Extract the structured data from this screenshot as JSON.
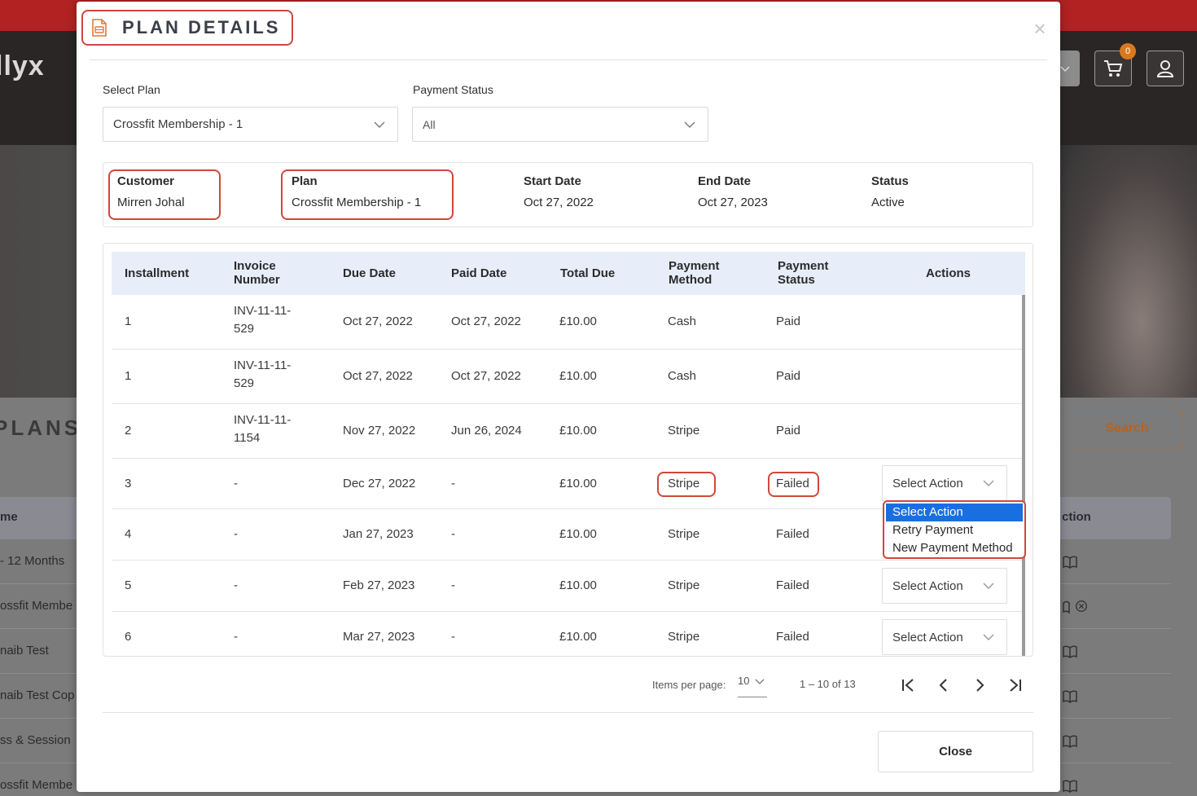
{
  "background": {
    "brand": "llyx",
    "cart_count": "0",
    "plans_title": "PLANS",
    "search_label": "Search",
    "table_header_left": "me",
    "table_header_right": "ction",
    "rows": [
      "- 12 Months",
      "ossfit Membe",
      "naib Test",
      "naib Test Cop",
      "ss & Session",
      "ossfit Membe"
    ]
  },
  "modal": {
    "title": "PLAN DETAILS",
    "close_symbol": "×",
    "filters": {
      "plan_label": "Select Plan",
      "plan_value": "Crossfit Membership - 1",
      "status_label": "Payment Status",
      "status_value": "All"
    },
    "summary": {
      "customer_label": "Customer",
      "customer_value": "Mirren Johal",
      "plan_label": "Plan",
      "plan_value": "Crossfit Membership - 1",
      "start_label": "Start Date",
      "start_value": "Oct 27, 2022",
      "end_label": "End Date",
      "end_value": "Oct 27, 2023",
      "status_label": "Status",
      "status_value": "Active"
    },
    "table": {
      "headers": {
        "installment": "Installment",
        "invoice": "Invoice Number",
        "due_date": "Due Date",
        "paid_date": "Paid Date",
        "total_due": "Total Due",
        "payment_method": "Payment Method",
        "payment_status": "Payment Status",
        "actions": "Actions"
      },
      "rows": [
        {
          "installment": "1",
          "invoice": "INV-11-11-529",
          "due": "Oct 27, 2022",
          "paid": "Oct 27, 2022",
          "total": "£10.00",
          "method": "Cash",
          "status": "Paid",
          "action": ""
        },
        {
          "installment": "1",
          "invoice": "INV-11-11-529",
          "due": "Oct 27, 2022",
          "paid": "Oct 27, 2022",
          "total": "£10.00",
          "method": "Cash",
          "status": "Paid",
          "action": ""
        },
        {
          "installment": "2",
          "invoice": "INV-11-11-1154",
          "due": "Nov 27, 2022",
          "paid": "Jun 26, 2024",
          "total": "£10.00",
          "method": "Stripe",
          "status": "Paid",
          "action": ""
        },
        {
          "installment": "3",
          "invoice": "-",
          "due": "Dec 27, 2022",
          "paid": "-",
          "total": "£10.00",
          "method": "Stripe",
          "status": "Failed",
          "action": "Select Action"
        },
        {
          "installment": "4",
          "invoice": "-",
          "due": "Jan 27, 2023",
          "paid": "-",
          "total": "£10.00",
          "method": "Stripe",
          "status": "Failed",
          "action": ""
        },
        {
          "installment": "5",
          "invoice": "-",
          "due": "Feb 27, 2023",
          "paid": "-",
          "total": "£10.00",
          "method": "Stripe",
          "status": "Failed",
          "action": "Select Action"
        },
        {
          "installment": "6",
          "invoice": "-",
          "due": "Mar 27, 2023",
          "paid": "-",
          "total": "£10.00",
          "method": "Stripe",
          "status": "Failed",
          "action": "Select Action"
        }
      ],
      "invoice_lines": [
        [
          "INV-11-11-",
          "529"
        ],
        [
          "INV-11-11-",
          "529"
        ],
        [
          "INV-11-11-",
          "1154"
        ]
      ]
    },
    "action_dropdown": {
      "options": [
        "Select Action",
        "Retry Payment",
        "New Payment Method"
      ],
      "selected": "Select Action"
    },
    "pagination": {
      "items_per_page_label": "Items per page:",
      "items_per_page": "10",
      "range": "1 – 10 of 13"
    },
    "close_label": "Close"
  },
  "colors": {
    "highlight": "#d0473b",
    "selected_option": "#1a6fe0",
    "table_header_bg": "#e7eefa",
    "accent_orange": "#d9791f"
  }
}
